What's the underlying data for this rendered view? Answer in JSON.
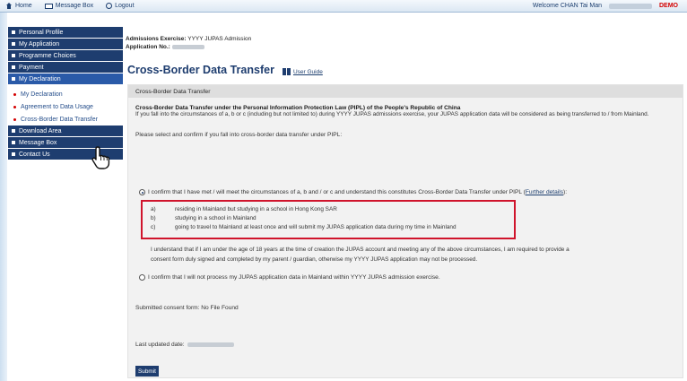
{
  "topbar": {
    "home_label": "Home",
    "message_box_label": "Message Box",
    "logout_label": "Logout",
    "welcome_text": "Welcome CHAN Tai Man",
    "demo_label": "DEMO"
  },
  "sidebar": {
    "items": [
      {
        "label": "Personal Profile"
      },
      {
        "label": "My Application"
      },
      {
        "label": "Programme Choices"
      },
      {
        "label": "Payment"
      },
      {
        "label": "My Declaration"
      }
    ],
    "subitems": [
      {
        "label": "My Declaration"
      },
      {
        "label": "Agreement to Data Usage"
      },
      {
        "label": "Cross-Border Data Transfer"
      }
    ],
    "items_after": [
      {
        "label": "Download Area"
      },
      {
        "label": "Message Box"
      },
      {
        "label": "Contact Us"
      }
    ]
  },
  "header": {
    "admissions_label": "Admissions Exercise:",
    "admissions_value": "YYYY JUPAS Admission",
    "application_label": "Application No.:"
  },
  "page": {
    "title": "Cross-Border Data Transfer",
    "user_guide": "User Guide"
  },
  "panel": {
    "heading": "Cross-Border Data Transfer",
    "intro_title": "Cross-Border Data Transfer under the Personal Information Protection Law (PIPL) of the People's Republic of China",
    "intro_text": "If you fall into the circumstances of a, b or c (including but not limited to) during YYYY JUPAS admissions exercise, your JUPAS application data will be considered as being transferred to / from Mainland.",
    "select_text": "Please select and confirm if you fall into cross-border data transfer under PIPL:",
    "option1": "I confirm that I have met / will meet the circumstances of a, b and / or c and understand this constitutes Cross-Border Data Transfer under PIPL (",
    "option1_link": "Further details",
    "option1_end": "):",
    "circumstances": [
      {
        "key": "a)",
        "text": "residing in Mainland but studying in a school in Hong Kong SAR"
      },
      {
        "key": "b)",
        "text": "studying in a school in Mainland"
      },
      {
        "key": "c)",
        "text": "going to travel to Mainland at least once and will submit my JUPAS application data during my time in Mainland"
      }
    ],
    "understanding_line1": "I understand that if I am under the age of 18 years at the time of creation the JUPAS account and meeting any of the above circumstances, I am required to provide a",
    "understanding_line2": "consent form duly signed and completed by my parent / guardian, otherwise my YYYY JUPAS application may not be processed.",
    "option2": "I confirm that I will not process my JUPAS application data in Mainland within YYYY JUPAS admission exercise.",
    "submitted_consent": "Submitted consent form: No File Found",
    "last_updated_label": "Last updated date:",
    "submit_label": "Submit"
  },
  "colors": {
    "nav_dark": "#1e3d6f",
    "nav_active": "#2a5aa8",
    "highlight_box": "#d0142c",
    "demo": "#d40000"
  }
}
